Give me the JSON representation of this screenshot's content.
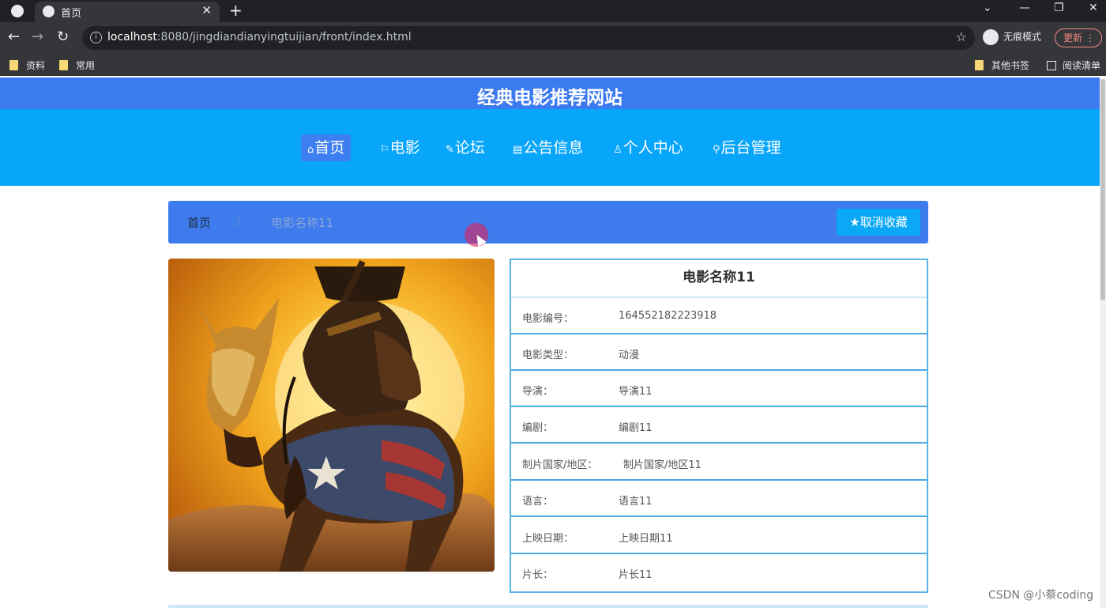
{
  "browser": {
    "tab_title": "首页",
    "url_host": "localhost",
    "url_rest": ":8080/jingdiandianyingtuijian/front/index.html",
    "profile_label": "无痕模式",
    "update_label": "更新",
    "bookmarks": [
      "资料",
      "常用"
    ],
    "other_bookmarks": "其他书签",
    "reading_list": "阅读清单"
  },
  "site": {
    "title": "经典电影推荐网站",
    "nav": [
      {
        "icon": "⌂",
        "label": "首页"
      },
      {
        "icon": "⚐",
        "label": "电影"
      },
      {
        "icon": "✎",
        "label": "论坛"
      },
      {
        "icon": "▤",
        "label": "公告信息"
      },
      {
        "icon": "♙",
        "label": "个人中心"
      },
      {
        "icon": "⚲",
        "label": "后台管理"
      }
    ]
  },
  "breadcrumb": {
    "home": "首页",
    "separator": "/",
    "current": "电影名称11"
  },
  "favorite_button": "取消收藏",
  "movie": {
    "name": "电影名称11",
    "fields": [
      {
        "label": "电影编号：",
        "value": "164552182223918"
      },
      {
        "label": "电影类型：",
        "value": "动漫"
      },
      {
        "label": "导演：",
        "value": "导演11"
      },
      {
        "label": "编剧：",
        "value": "编剧11"
      },
      {
        "label": "制片国家/地区：",
        "value": "制片国家/地区11"
      },
      {
        "label": "语言：",
        "value": "语言11"
      },
      {
        "label": "上映日期：",
        "value": "上映日期11"
      },
      {
        "label": "片长：",
        "value": "片长11"
      }
    ]
  },
  "watermark": "CSDN @小蔡coding"
}
